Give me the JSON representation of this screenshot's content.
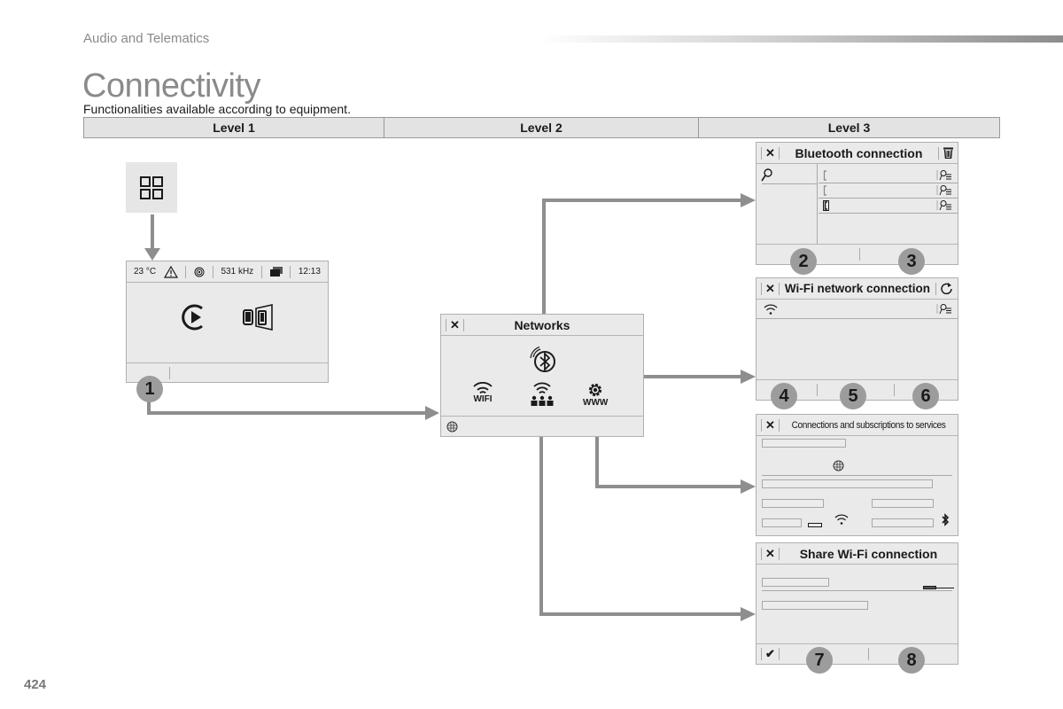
{
  "header": {
    "section": "Audio and Telematics",
    "title": "Connectivity",
    "subtitle": "Functionalities available according to equipment.",
    "page_number": "424"
  },
  "levels": [
    "Level 1",
    "Level 2",
    "Level 3"
  ],
  "menu_button": {
    "icon": "grid-menu-icon"
  },
  "home_screen": {
    "temperature": "23 °C",
    "warning_icon": "warning-triangle-icon",
    "radio_icon": "radio-signal-icon",
    "frequency": "531 kHz",
    "messages_icon": "messages-icon",
    "time": "12:13",
    "apps": [
      "play-icon",
      "mirror-screen-icon"
    ],
    "badge": "1"
  },
  "networks": {
    "title": "Networks",
    "close": "✕",
    "bluetooth_icon": "bluetooth-icon",
    "items": [
      {
        "label": "WIFI",
        "icon": "wifi-icon"
      },
      {
        "label": "",
        "icon": "share-wifi-icon"
      },
      {
        "label": "WWW",
        "icon": "gear-www-icon"
      }
    ],
    "footer_icon": "globe-icon"
  },
  "bluetooth_panel": {
    "title": "Bluetooth connection",
    "close": "✕",
    "action_icon": "trash-icon",
    "search_icon": "search-icon",
    "devices": [
      {
        "icon": "phone-outline-icon",
        "settings": "device-settings-icon"
      },
      {
        "icon": "phone-outline-icon",
        "settings": "device-settings-icon"
      },
      {
        "icon": "phone-connected-icon",
        "settings": "device-settings-icon"
      }
    ],
    "badges": [
      "2",
      "3"
    ]
  },
  "wifi_panel": {
    "title": "Wi-Fi network connection",
    "close": "✕",
    "action_icon": "refresh-icon",
    "badges": [
      "4",
      "5",
      "6"
    ]
  },
  "services_panel": {
    "title": "Connections and subscriptions to services",
    "close": "✕"
  },
  "share_panel": {
    "title": "Share Wi-Fi connection",
    "close": "✕",
    "confirm": "✔",
    "badges": [
      "7",
      "8"
    ]
  }
}
